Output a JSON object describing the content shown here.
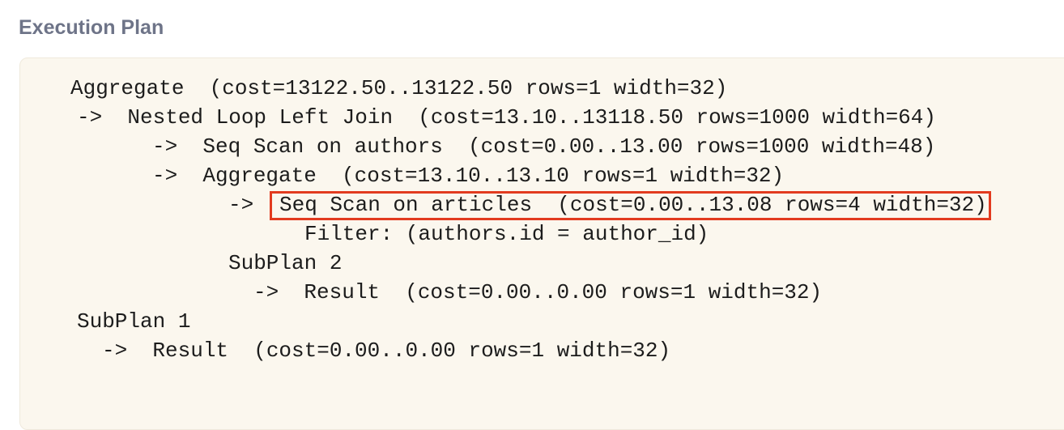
{
  "section": {
    "title": "Execution Plan"
  },
  "plan": {
    "lines": [
      {
        "text": "Aggregate  (cost=13122.50..13122.50 rows=1 width=32)"
      },
      {
        "text": "->  Nested Loop Left Join  (cost=13.10..13118.50 rows=1000 width=64)"
      },
      {
        "text": "->  Seq Scan on authors  (cost=0.00..13.00 rows=1000 width=48)"
      },
      {
        "text": "->  Aggregate  (cost=13.10..13.10 rows=1 width=32)"
      },
      {
        "text": "->  "
      },
      {
        "text": "Seq Scan on articles  (cost=0.00..13.08 rows=4 width=32)",
        "highlighted": true
      },
      {
        "text": "Filter: (authors.id = author_id)"
      },
      {
        "text": "SubPlan 2"
      },
      {
        "text": "->  Result  (cost=0.00..0.00 rows=1 width=32)"
      },
      {
        "text": "SubPlan 1"
      },
      {
        "text": "->  Result  (cost=0.00..0.00 rows=1 width=32)"
      }
    ],
    "highlight_color": "#e23b1f",
    "background_color": "#fbf7ee"
  }
}
